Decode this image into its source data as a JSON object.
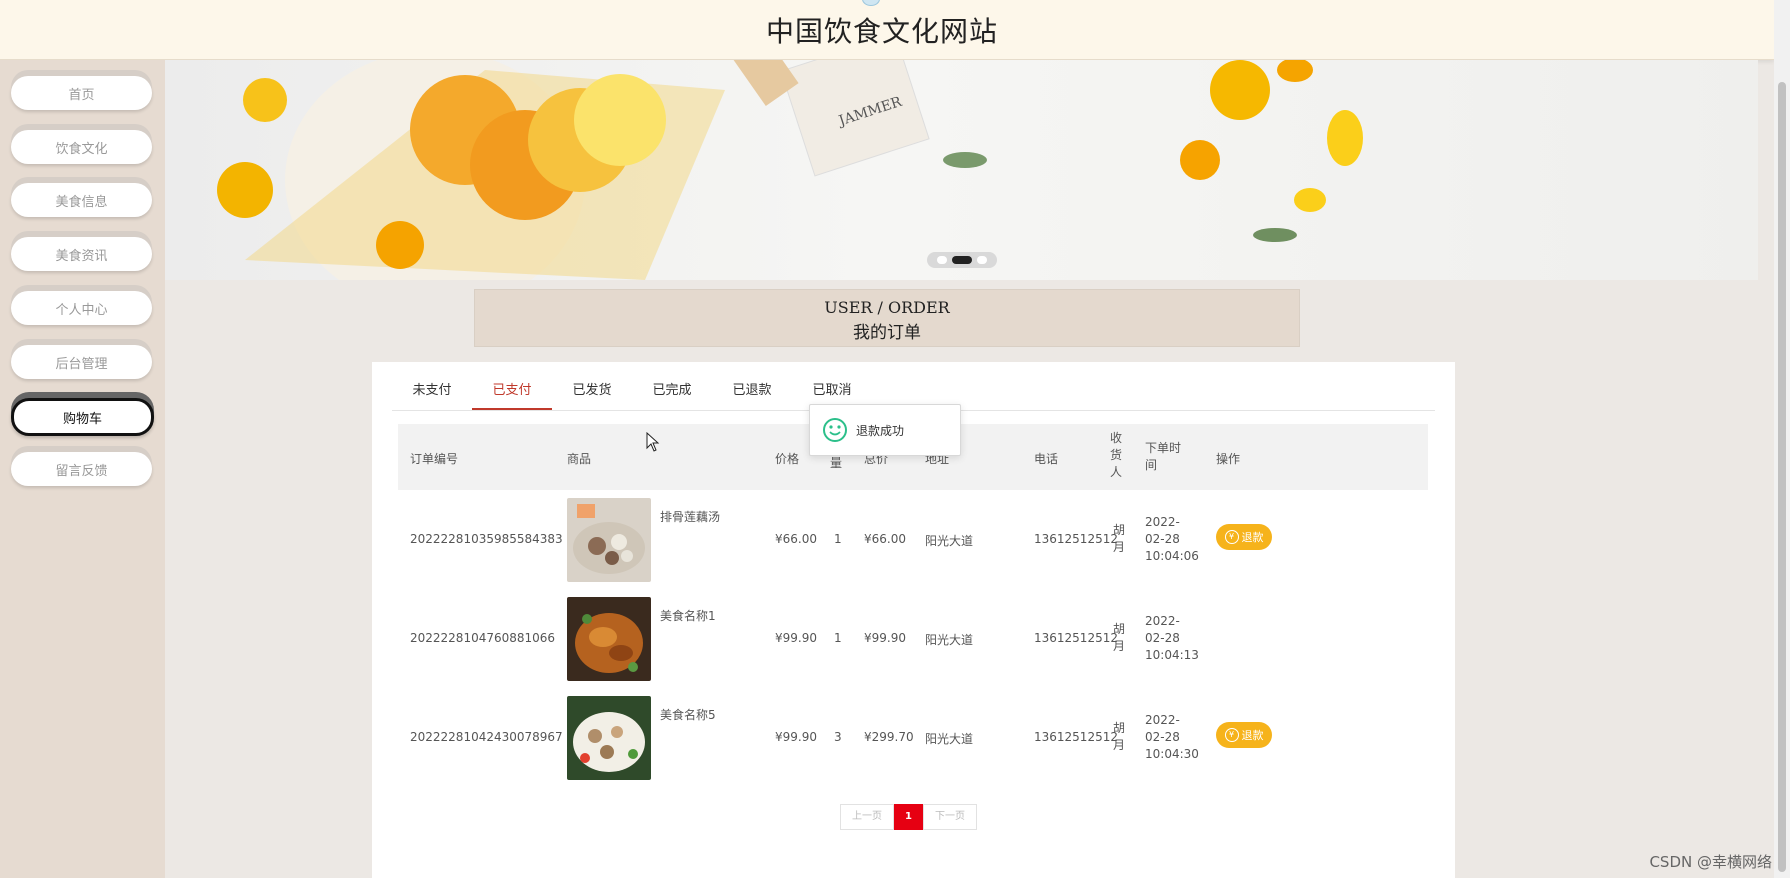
{
  "header": {
    "title": "中国饮食文化网站"
  },
  "sidebar": {
    "items": [
      {
        "label": "首页"
      },
      {
        "label": "饮食文化"
      },
      {
        "label": "美食信息"
      },
      {
        "label": "美食资讯"
      },
      {
        "label": "个人中心"
      },
      {
        "label": "后台管理"
      },
      {
        "label": "购物车",
        "active": true
      },
      {
        "label": "留言反馈"
      }
    ]
  },
  "banner": {
    "slide_count": 3,
    "active_slide": 2,
    "jar_label": "JAMMER"
  },
  "page_heading": {
    "en": "USER / ORDER",
    "zh": "我的订单"
  },
  "tabs": [
    {
      "label": "未支付"
    },
    {
      "label": "已支付",
      "active": true
    },
    {
      "label": "已发货"
    },
    {
      "label": "已完成"
    },
    {
      "label": "已退款"
    },
    {
      "label": "已取消"
    }
  ],
  "table": {
    "headers": {
      "order_no": "订单编号",
      "product": "商品",
      "price": "价格",
      "qty_a": "数",
      "qty_b": "量",
      "total": "总价",
      "address": "地址",
      "phone": "电话",
      "recv_a": "收",
      "recv_b": "货",
      "recv_c": "人",
      "time_a": "下单时",
      "time_b": "间",
      "action": "操作"
    },
    "rows": [
      {
        "order_no": "20222281035985584383",
        "product": "排骨莲藕汤",
        "price": "¥66.00",
        "qty": "1",
        "total": "¥66.00",
        "address": "阳光大道",
        "phone": "13612512512",
        "recv_a": "胡",
        "recv_b": "月",
        "time_a": "2022-",
        "time_b": "02-28",
        "time_c": "10:04:06",
        "refund": "退款"
      },
      {
        "order_no": "2022228104760881066",
        "product": "美食名称1",
        "price": "¥99.90",
        "qty": "1",
        "total": "¥99.90",
        "address": "阳光大道",
        "phone": "13612512512",
        "recv_a": "胡",
        "recv_b": "月",
        "time_a": "2022-",
        "time_b": "02-28",
        "time_c": "10:04:13",
        "refund": ""
      },
      {
        "order_no": "20222281042430078967",
        "product": "美食名称5",
        "price": "¥99.90",
        "qty": "3",
        "total": "¥299.70",
        "address": "阳光大道",
        "phone": "13612512512",
        "recv_a": "胡",
        "recv_b": "月",
        "time_a": "2022-",
        "time_b": "02-28",
        "time_c": "10:04:30",
        "refund": "退款"
      }
    ]
  },
  "toast": {
    "message": "退款成功",
    "icon": "smile-icon"
  },
  "pagination": {
    "prev": "上一页",
    "current": "1",
    "next": "下一页"
  },
  "watermark": "CSDN @幸横网络",
  "colors": {
    "accent": "#c0392b",
    "refund": "#f6b31b",
    "page_current": "#e60012",
    "header_bg": "#fdf7ea"
  }
}
